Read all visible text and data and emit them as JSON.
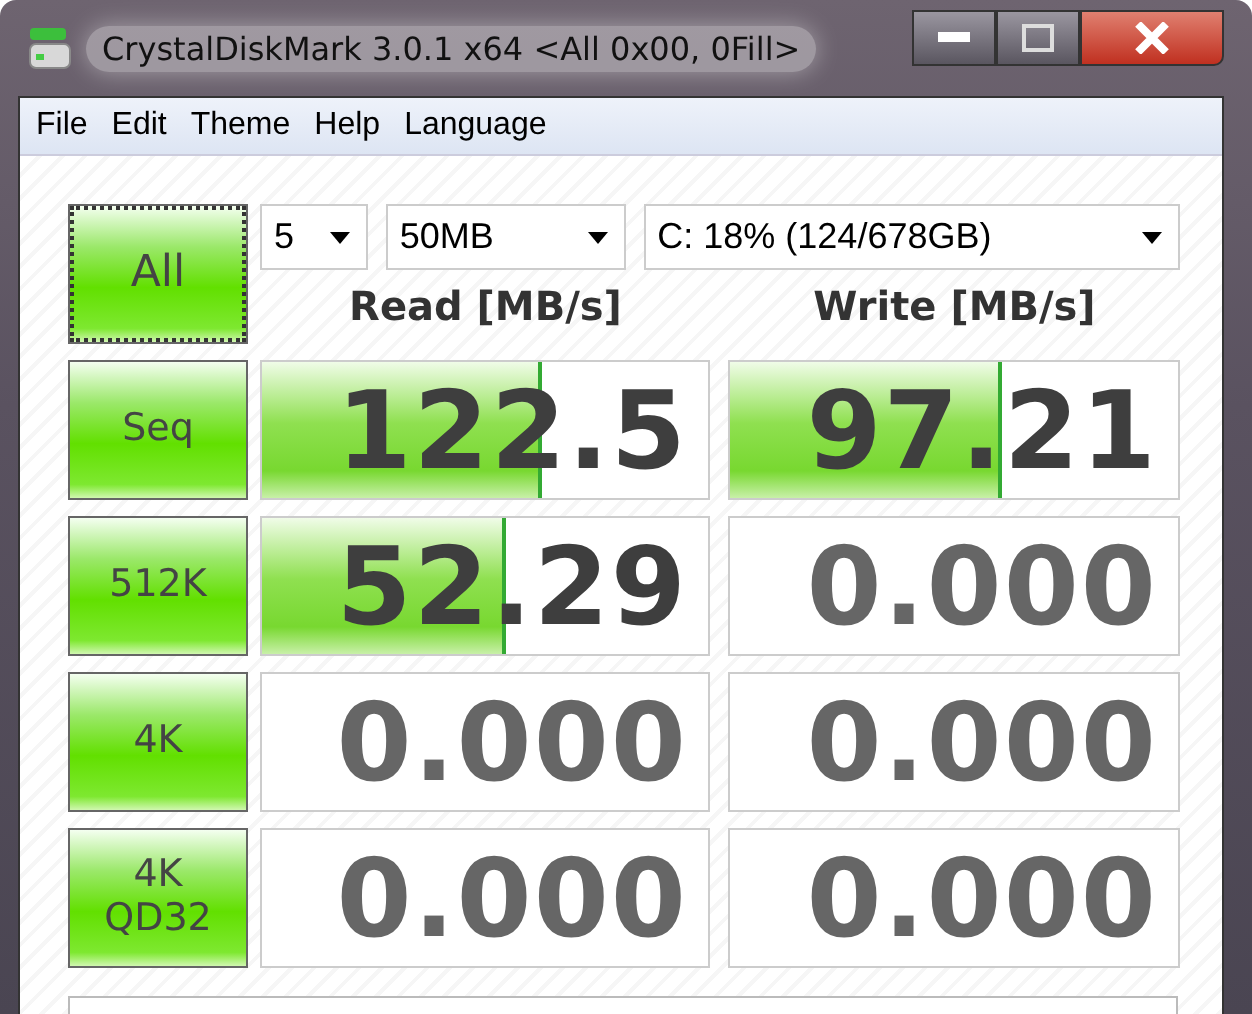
{
  "window": {
    "title": "CrystalDiskMark 3.0.1 x64 <All 0x00, 0Fill>"
  },
  "menu": [
    "File",
    "Edit",
    "Theme",
    "Help",
    "Language"
  ],
  "all_button": "All",
  "selects": [
    {
      "value": "5"
    },
    {
      "value": "50MB"
    },
    {
      "value": "C: 18% (124/678GB)"
    }
  ],
  "columns": [
    "Read [MB/s]",
    "Write [MB/s]"
  ],
  "rows": [
    {
      "test": "Seq",
      "read": {
        "value": "122.5",
        "level": 0.62
      },
      "write": {
        "value": "97.21",
        "level": 0.6
      }
    },
    {
      "test": "512K",
      "read": {
        "value": "52.29",
        "level": 0.54
      },
      "write": {
        "value": "0.000",
        "level": 0
      }
    },
    {
      "test": "4K",
      "read": {
        "value": "0.000",
        "level": 0
      },
      "write": {
        "value": "0.000",
        "level": 0
      }
    },
    {
      "test": "4K\nQD32",
      "read": {
        "value": "0.000",
        "level": 0
      },
      "write": {
        "value": "0.000",
        "level": 0
      }
    }
  ]
}
